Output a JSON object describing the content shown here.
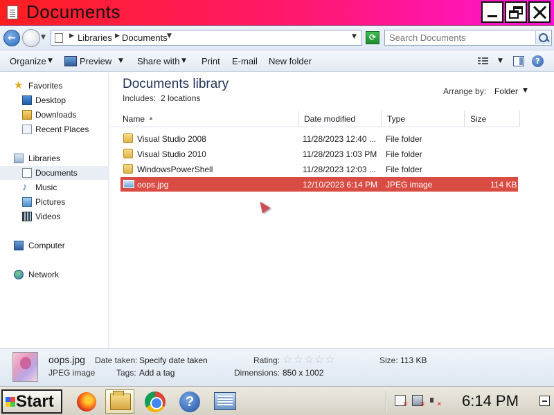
{
  "window": {
    "title": "Documents",
    "title_icon": "document-icon"
  },
  "address": {
    "crumbs": [
      "Libraries",
      "Documents"
    ],
    "search_placeholder": "Search Documents"
  },
  "toolbar": {
    "organize": "Organize",
    "preview": "Preview",
    "share_with": "Share with",
    "print": "Print",
    "email": "E-mail",
    "new_folder": "New folder"
  },
  "nav": {
    "favorites": {
      "label": "Favorites",
      "items": [
        {
          "label": "Desktop"
        },
        {
          "label": "Downloads"
        },
        {
          "label": "Recent Places"
        }
      ]
    },
    "libraries": {
      "label": "Libraries",
      "items": [
        {
          "label": "Documents",
          "selected": true
        },
        {
          "label": "Music"
        },
        {
          "label": "Pictures"
        },
        {
          "label": "Videos"
        }
      ]
    },
    "computer": "Computer",
    "network": "Network"
  },
  "library": {
    "title": "Documents library",
    "includes_label": "Includes:",
    "includes_value": "2 locations",
    "arrange_label": "Arrange by:",
    "arrange_value": "Folder"
  },
  "columns": {
    "name": "Name",
    "date": "Date modified",
    "type": "Type",
    "size": "Size"
  },
  "files": [
    {
      "name": "Visual Studio 2008",
      "date": "11/28/2023 12:40 ...",
      "type": "File folder",
      "size": "",
      "icon": "folder-icon"
    },
    {
      "name": "Visual Studio 2010",
      "date": "11/28/2023 1:03 PM",
      "type": "File folder",
      "size": "",
      "icon": "folder-icon"
    },
    {
      "name": "WindowsPowerShell",
      "date": "11/28/2023 12:03 ...",
      "type": "File folder",
      "size": "",
      "icon": "folder-icon"
    },
    {
      "name": "oops.jpg",
      "date": "12/10/2023 6:14 PM",
      "type": "JPEG image",
      "size": "114 KB",
      "icon": "image-file-icon",
      "selected": true
    }
  ],
  "details": {
    "name": "oops.jpg",
    "type": "JPEG image",
    "date_taken_label": "Date taken:",
    "date_taken_value": "Specify date taken",
    "tags_label": "Tags:",
    "tags_value": "Add a tag",
    "rating_label": "Rating:",
    "rating_stars": 0,
    "dimensions_label": "Dimensions:",
    "dimensions_value": "850 x 1002",
    "size_label": "Size:",
    "size_value": "113 KB"
  },
  "taskbar": {
    "start_label": "Start",
    "apps": [
      "firefox-icon",
      "explorer-icon",
      "chrome-icon",
      "help-icon",
      "network-icon"
    ],
    "clock": "6:14 PM"
  },
  "colors": {
    "title_gradient_start": "#ff1f1f",
    "title_gradient_end": "#ff14d8",
    "selection": "#d94c43"
  }
}
